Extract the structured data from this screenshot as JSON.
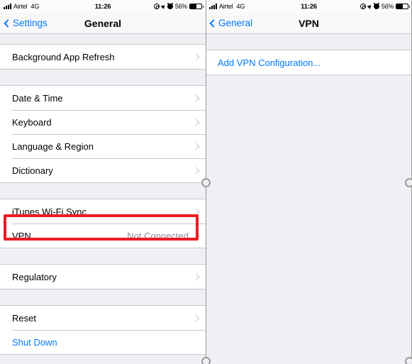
{
  "status_bar": {
    "carrier": "Airtel",
    "network": "4G",
    "time": "11:26",
    "battery_percent": "56%",
    "icons": [
      "signal-bars-icon",
      "portrait-lock-icon",
      "location-arrow-icon",
      "alarm-clock-icon",
      "battery-icon"
    ]
  },
  "colors": {
    "accent_blue": "#007aff",
    "highlight_red": "#ec1c24",
    "value_gray": "#8e8e93",
    "group_background": "#efeff4",
    "row_background": "#ffffff",
    "separator": "#c8c7cc"
  },
  "left_panel": {
    "nav": {
      "back_label": "Settings",
      "title": "General"
    },
    "sections": [
      {
        "rows": [
          {
            "label": "Background App Refresh",
            "value": "",
            "accessory": "chevron-right-icon",
            "style": "normal",
            "highlighted": false
          }
        ]
      },
      {
        "rows": [
          {
            "label": "Date & Time",
            "value": "",
            "accessory": "chevron-right-icon",
            "style": "normal",
            "highlighted": false
          },
          {
            "label": "Keyboard",
            "value": "",
            "accessory": "chevron-right-icon",
            "style": "normal",
            "highlighted": false
          },
          {
            "label": "Language & Region",
            "value": "",
            "accessory": "chevron-right-icon",
            "style": "normal",
            "highlighted": false
          },
          {
            "label": "Dictionary",
            "value": "",
            "accessory": "chevron-right-icon",
            "style": "normal",
            "highlighted": false
          }
        ]
      },
      {
        "rows": [
          {
            "label": "iTunes Wi-Fi Sync",
            "value": "",
            "accessory": "chevron-right-icon",
            "style": "normal",
            "highlighted": false
          },
          {
            "label": "VPN",
            "value": "Not Connected",
            "accessory": "chevron-right-icon",
            "style": "normal",
            "highlighted": true
          }
        ]
      },
      {
        "rows": [
          {
            "label": "Regulatory",
            "value": "",
            "accessory": "chevron-right-icon",
            "style": "normal",
            "highlighted": false
          }
        ]
      },
      {
        "rows": [
          {
            "label": "Reset",
            "value": "",
            "accessory": "chevron-right-icon",
            "style": "normal",
            "highlighted": false
          },
          {
            "label": "Shut Down",
            "value": "",
            "accessory": "none",
            "style": "link",
            "highlighted": false
          }
        ]
      }
    ]
  },
  "right_panel": {
    "nav": {
      "back_label": "General",
      "title": "VPN"
    },
    "sections": [
      {
        "rows": [
          {
            "label": "Add VPN Configuration...",
            "value": "",
            "accessory": "none",
            "style": "link",
            "highlighted": false
          }
        ]
      }
    ]
  }
}
